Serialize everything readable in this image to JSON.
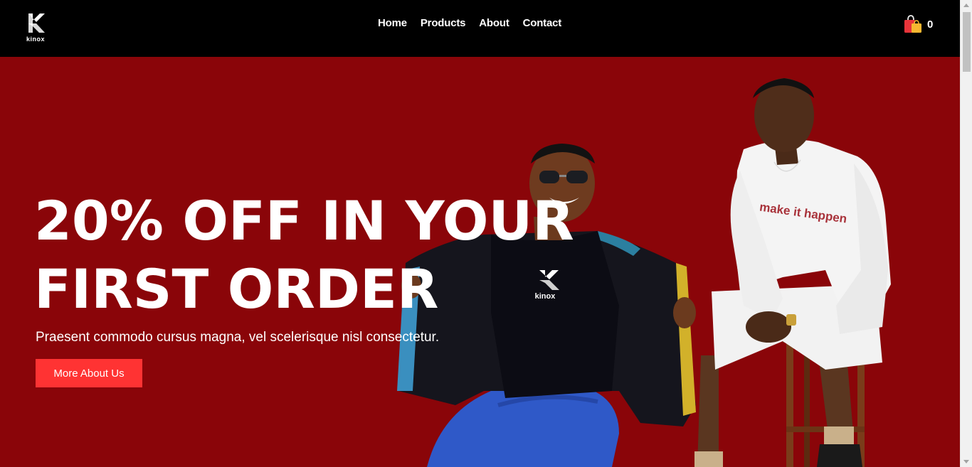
{
  "brand": {
    "name": "kinox"
  },
  "nav": {
    "links": [
      {
        "label": "Home"
      },
      {
        "label": "Products"
      },
      {
        "label": "About"
      },
      {
        "label": "Contact"
      }
    ]
  },
  "cart": {
    "icon": "shopping-bag-icon",
    "count": "0"
  },
  "hero": {
    "title": "20% OFF IN YOUR FIRST ORDER",
    "subtitle": "Praesent commodo cursus magna, vel scelerisque nisl consectetur.",
    "button_label": "More About Us",
    "shirt_print": "kinox",
    "sweater_print": "make it happen"
  },
  "colors": {
    "nav_bg": "#000000",
    "hero_bg": "#8a0509",
    "accent": "#ff3333",
    "text": "#ffffff"
  }
}
